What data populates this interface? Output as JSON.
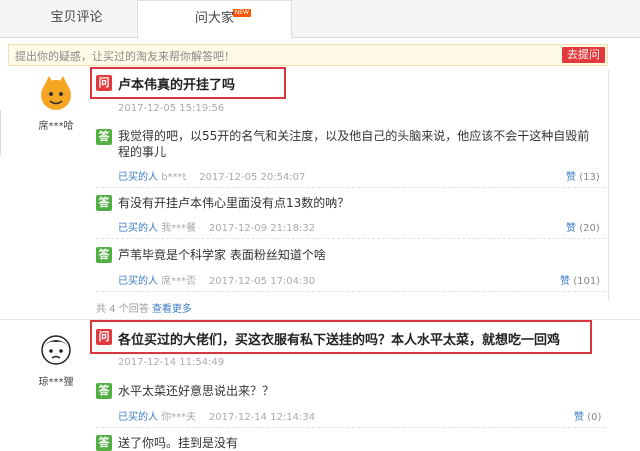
{
  "tabs": [
    {
      "label": "宝贝评论"
    },
    {
      "label": "问大家",
      "badge": "NEW"
    }
  ],
  "ask": {
    "placeholder": "提出你的疑惑，让买过的淘友来帮你解答吧！",
    "button": "去提问"
  },
  "questions": [
    {
      "user": "席***哈",
      "question": "卢本伟真的开挂了吗",
      "time": "2017-12-05 15:19:56",
      "answers": [
        {
          "text": "我觉得的吧，以55开的名气和关注度，以及他自己的头脑来说，他应该不会干这种自毁前程的事儿",
          "buyer_label": "已买的人",
          "buyer": "b***t",
          "time": "2017-12-05 20:54:07",
          "like_label": "赞",
          "likes": "(13)"
        },
        {
          "text": "有没有开挂卢本伟心里面没有点13数的呐？",
          "buyer_label": "已买的人",
          "buyer": "我***餐",
          "time": "2017-12-09 21:18:32",
          "like_label": "赞",
          "likes": "(20)"
        },
        {
          "text": "芦苇毕竟是个科学家 表面粉丝知道个啥",
          "buyer_label": "已买的人",
          "buyer": "席***否",
          "time": "2017-12-05 17:04:30",
          "like_label": "赞",
          "likes": "(101)"
        }
      ],
      "more": {
        "count_text": "共 4 个回答",
        "link": "查看更多"
      }
    },
    {
      "user": "琼***狸",
      "question": "各位买过的大佬们，买这衣服有私下送挂的吗？本人水平太菜，就想吃一回鸡",
      "time": "2017-12-14 11:54:49",
      "answers": [
        {
          "text": "水平太菜还好意思说出来？？",
          "buyer_label": "已买的人",
          "buyer": "你***夫",
          "time": "2017-12-14 12:14:34",
          "like_label": "赞",
          "likes": "(0)"
        },
        {
          "text": "送了你吗。挂到是没有"
        }
      ]
    }
  ],
  "badges": {
    "question": "问",
    "answer": "答"
  },
  "colors": {
    "question_badge": "#e4393c",
    "answer_badge": "#52b043",
    "highlight_box": "#d9363e",
    "link": "#3c7bc7"
  }
}
